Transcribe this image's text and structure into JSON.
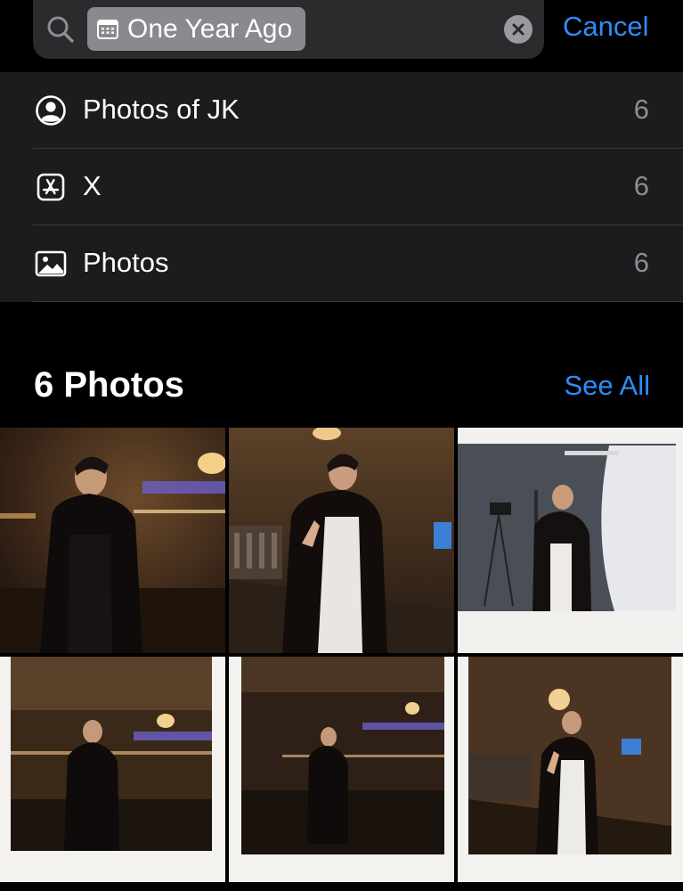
{
  "search": {
    "token_label": "One Year Ago",
    "cancel_label": "Cancel",
    "icons": {
      "search": "magnifier-icon",
      "token": "calendar-icon",
      "clear": "clear-x-icon"
    }
  },
  "suggestions": [
    {
      "icon": "person-circle-icon",
      "label": "Photos of JK",
      "count": "6"
    },
    {
      "icon": "app-store-icon",
      "label": "X",
      "count": "6"
    },
    {
      "icon": "photo-icon",
      "label": "Photos",
      "count": "6"
    }
  ],
  "photos_section": {
    "title": "6 Photos",
    "see_all_label": "See All",
    "thumbnails": [
      {
        "scene": "station hall, person in black, blurred motion"
      },
      {
        "scene": "balcony, peace sign, white pants"
      },
      {
        "scene": "studio polaroid, peace sign, white backdrop"
      },
      {
        "scene": "station polaroid, person in black"
      },
      {
        "scene": "station polaroid, wide hall"
      },
      {
        "scene": "balcony polaroid, peace sign"
      }
    ]
  },
  "colors": {
    "accent": "#2f8cf8",
    "list_bg": "#1c1c1e",
    "field_bg": "#2b2b2e"
  }
}
